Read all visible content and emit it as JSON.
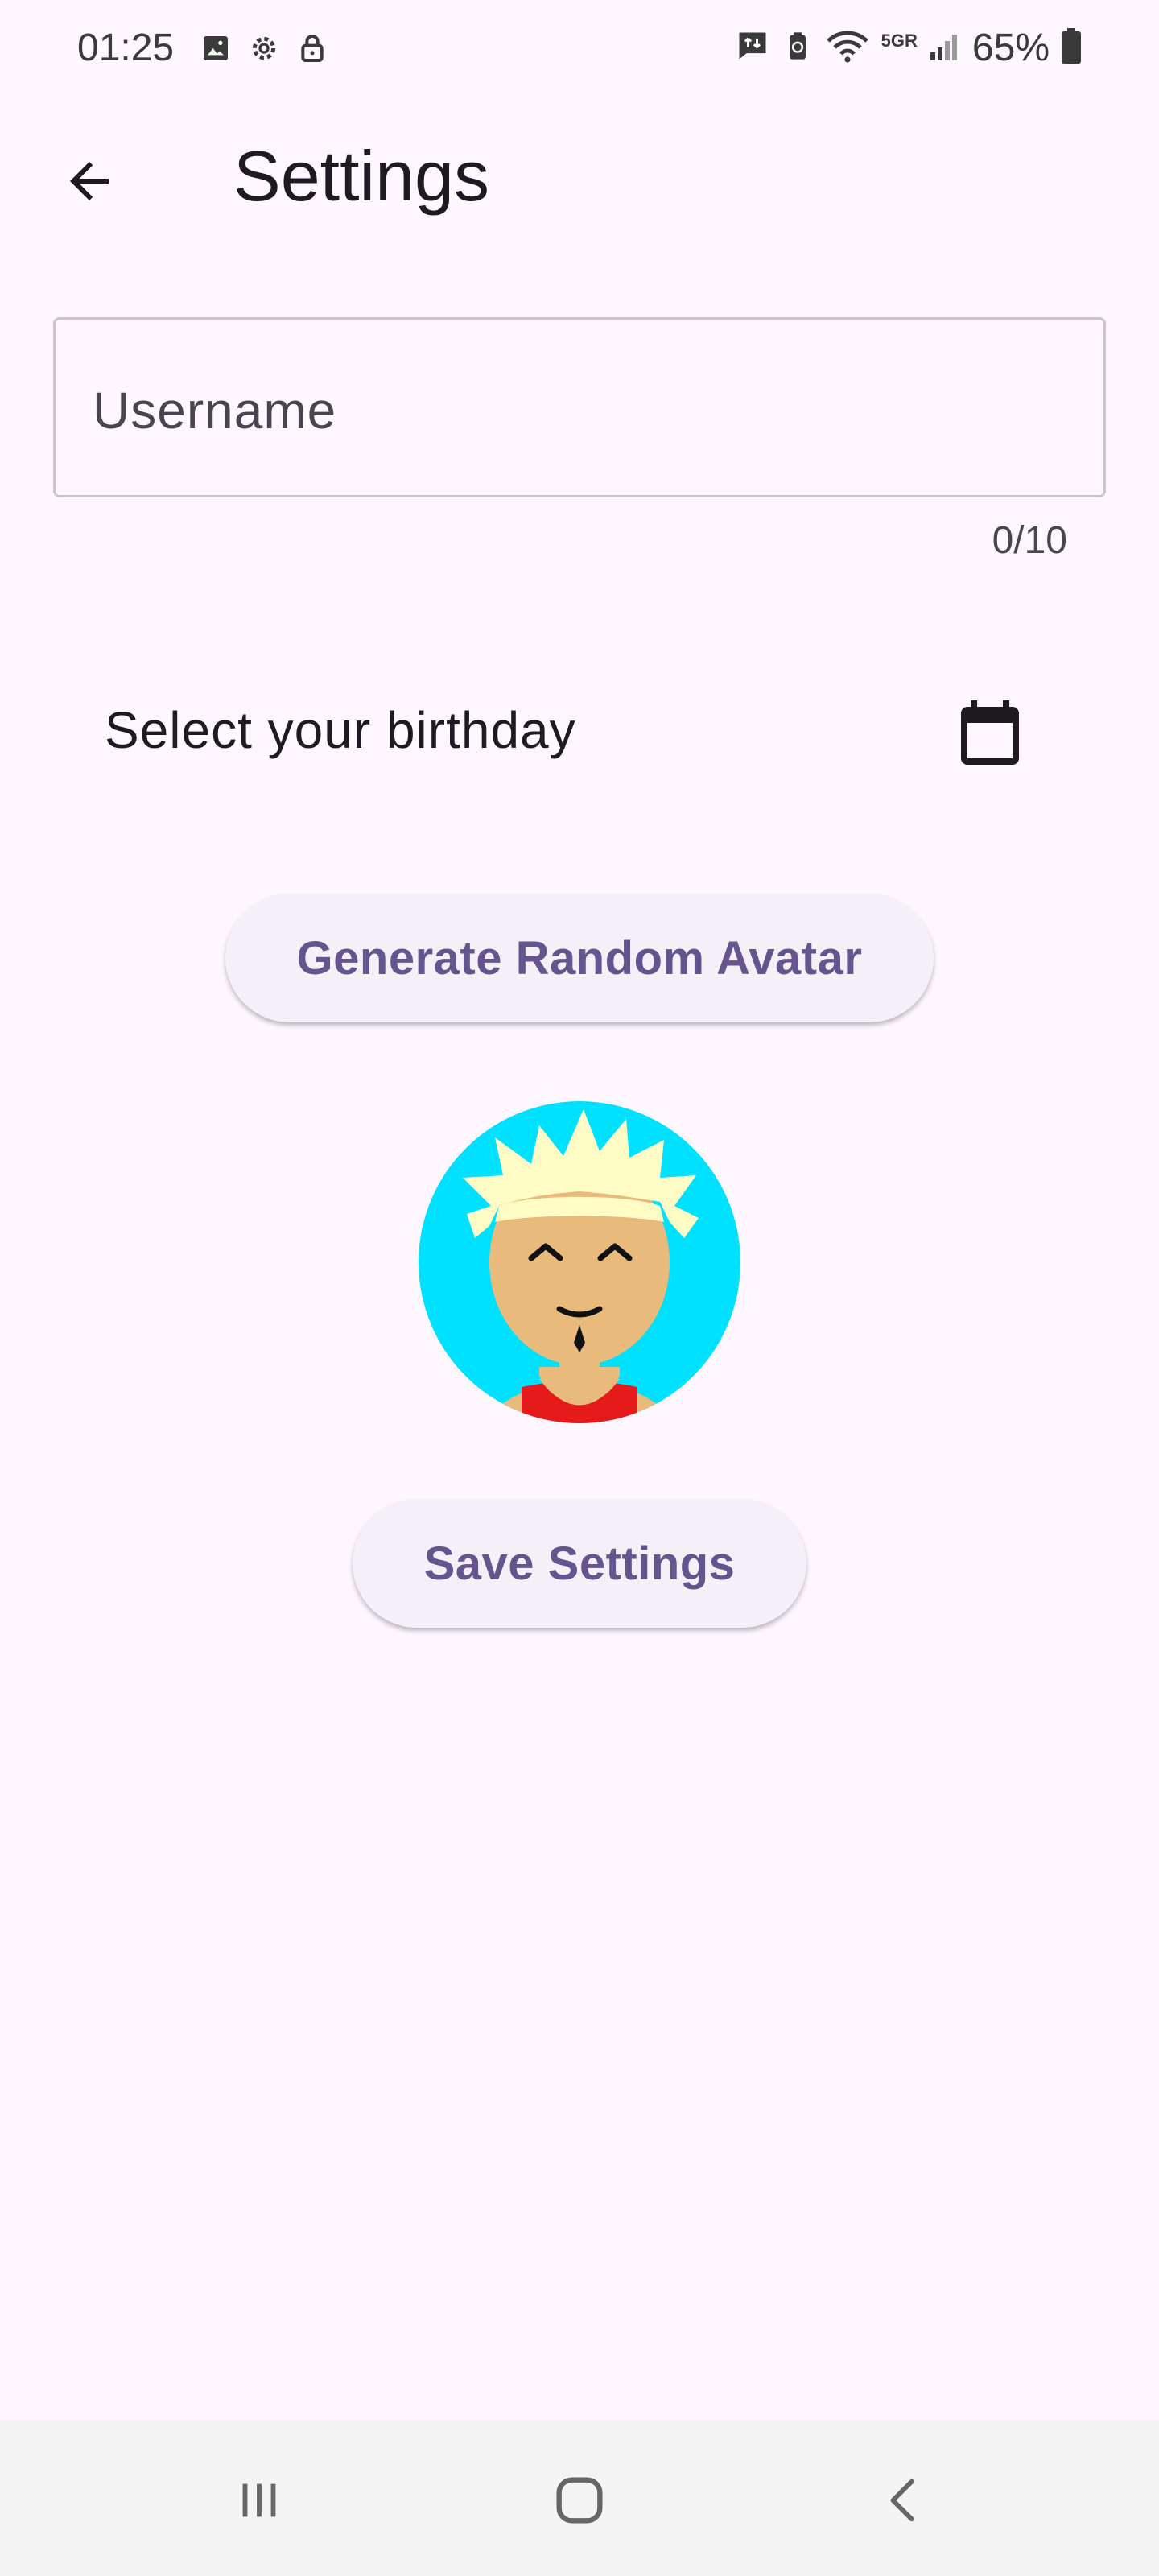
{
  "status_bar": {
    "time": "01:25",
    "network": "5GR",
    "battery": "65%",
    "left_icons": [
      "image-icon",
      "gear-icon",
      "lock-icon"
    ],
    "right_icons": [
      "message-sync-icon",
      "battery-saver-icon",
      "wifi-icon",
      "signal-icon",
      "battery-icon"
    ]
  },
  "app_bar": {
    "title": "Settings",
    "back_icon": "arrow-back-icon"
  },
  "username_field": {
    "value": "",
    "placeholder": "Username",
    "counter": "0/10"
  },
  "birthday": {
    "label": "Select your birthday",
    "icon": "calendar-icon"
  },
  "generate_button": {
    "label": "Generate Random Avatar"
  },
  "avatar": {
    "background_color": "#00E1FF"
  },
  "save_button": {
    "label": "Save Settings"
  },
  "nav_bar": {
    "icons": [
      "recent-apps-icon",
      "home-icon",
      "back-icon"
    ]
  },
  "colors": {
    "background": "#FEF7FF",
    "accent": "#65558F",
    "outline": "#CAC4D0",
    "button_surface": "#F5F0F7"
  }
}
